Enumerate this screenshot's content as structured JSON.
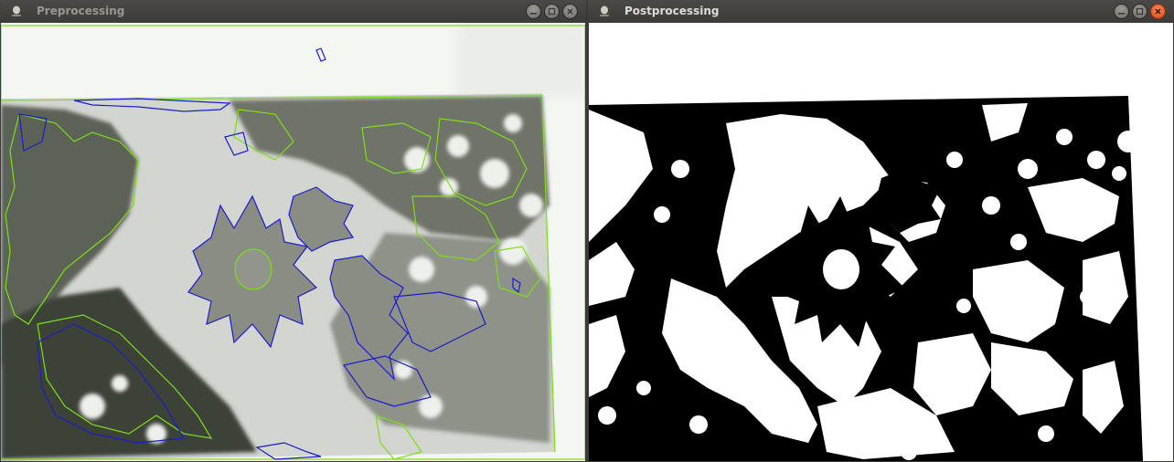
{
  "windows": [
    {
      "title": "Preprocessing",
      "active": false,
      "buttons": [
        "minimize-icon",
        "maximize-icon",
        "close-icon"
      ],
      "content": "camera-frame-with-contours",
      "contour_colors": {
        "outer": "#7cdd1c",
        "inner": "#1c1ccc"
      }
    },
    {
      "title": "Postprocessing",
      "active": true,
      "buttons": [
        "minimize-icon",
        "maximize-icon",
        "close-icon"
      ],
      "content": "binary-threshold-mask",
      "mask_colors": {
        "foreground": "#ffffff",
        "background": "#000000"
      }
    }
  ],
  "theme": {
    "titlebar": "#3c3b37",
    "title_text_active": "#dfdbd2",
    "title_text_inactive": "#99978f",
    "close_active": "#e0561e"
  }
}
